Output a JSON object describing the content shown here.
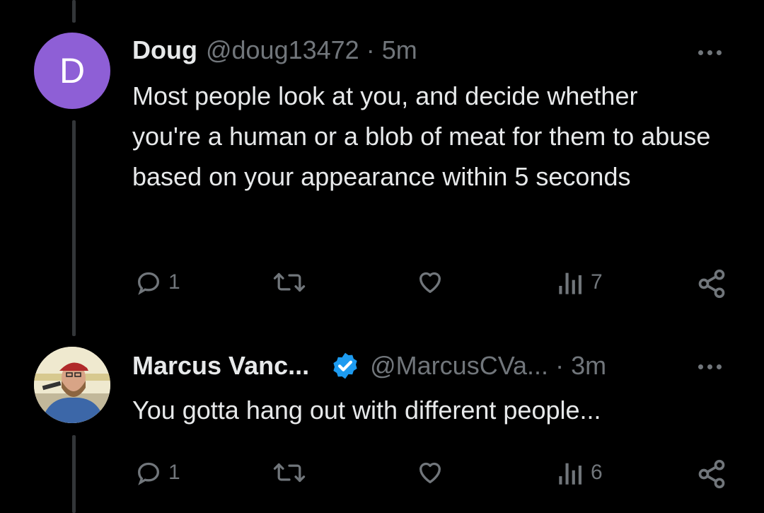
{
  "tweets": [
    {
      "avatar_letter": "D",
      "avatar_color": "#8e5fd6",
      "name": "Doug",
      "handle": "@doug13472",
      "separator": "·",
      "time": "5m",
      "text": "Most people look at you, and decide whether you're a human or a blob of meat for them to abuse based on your appearance within 5 seconds",
      "reply_count": "1",
      "view_count": "7"
    },
    {
      "name": "Marcus Vanc...",
      "verified": true,
      "handle": "@MarcusCVa...",
      "separator": "·",
      "time": "3m",
      "text": "You gotta hang out with different people...",
      "reply_count": "1",
      "view_count": "6"
    }
  ],
  "colors": {
    "background": "#000000",
    "text": "#e7e9ea",
    "muted": "#71767b",
    "verified": "#1d9bf0"
  },
  "icons": [
    "more-icon",
    "reply-icon",
    "retweet-icon",
    "like-icon",
    "views-icon",
    "share-icon",
    "verified-badge-icon"
  ]
}
